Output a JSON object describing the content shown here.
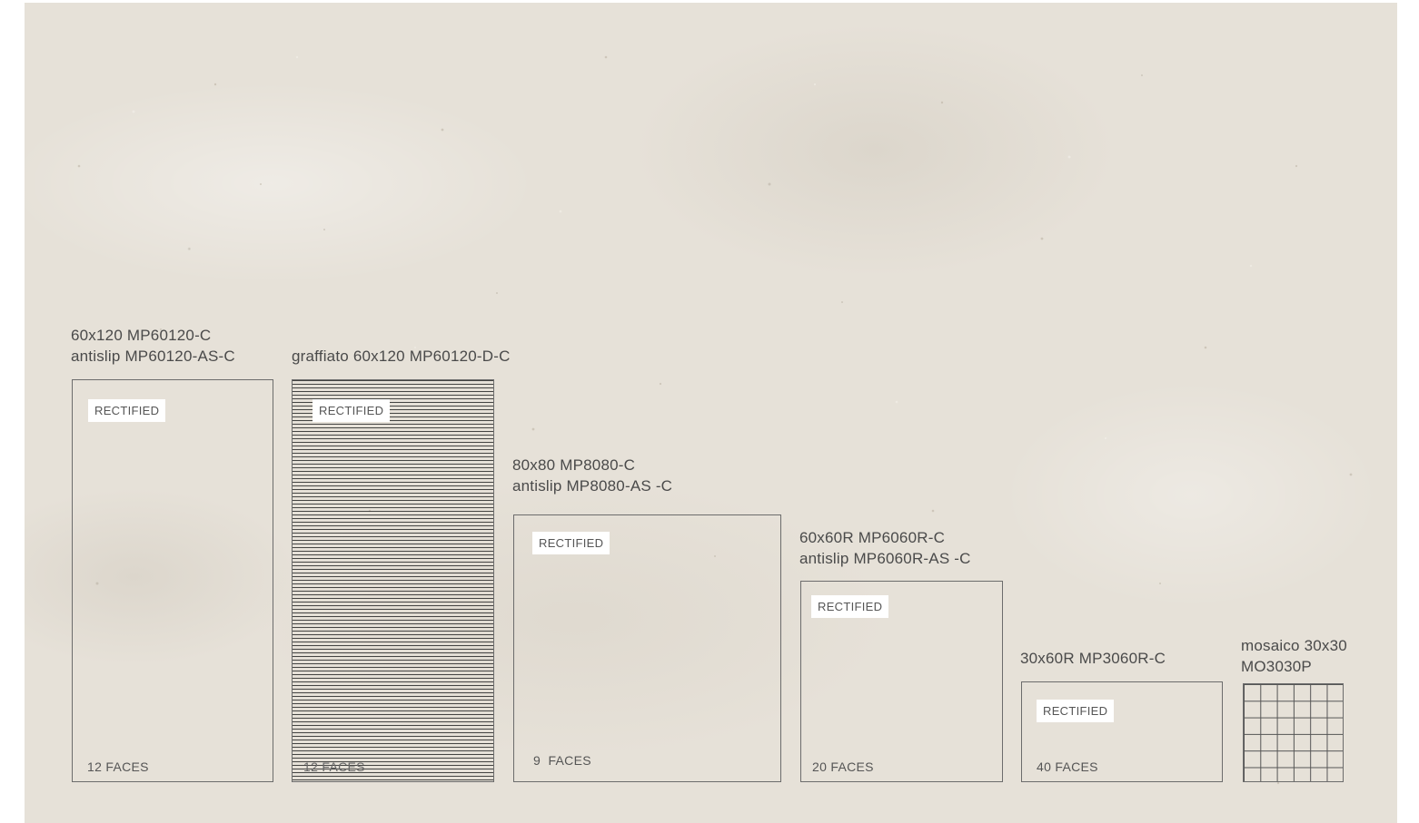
{
  "tiles": [
    {
      "line1": "60x120 MP60120-C",
      "line2": "antislip MP60120-AS-C",
      "badge": "RECTIFIED",
      "faces": "12 FACES"
    },
    {
      "line1": "graffiato 60x120 MP60120-D-C",
      "badge": "RECTIFIED",
      "faces": "12 FACES"
    },
    {
      "line1": "80x80 MP8080-C",
      "line2": "antislip MP8080-AS -C",
      "badge": "RECTIFIED",
      "faces": "9  FACES"
    },
    {
      "line1": "60x60R MP6060R-C",
      "line2": "antislip MP6060R-AS -C",
      "badge": "RECTIFIED",
      "faces": "20 FACES"
    },
    {
      "line1": "30x60R MP3060R-C",
      "badge": "RECTIFIED",
      "faces": "40 FACES"
    },
    {
      "line1": "mosaico 30x30",
      "line2": "MO3030P"
    }
  ]
}
